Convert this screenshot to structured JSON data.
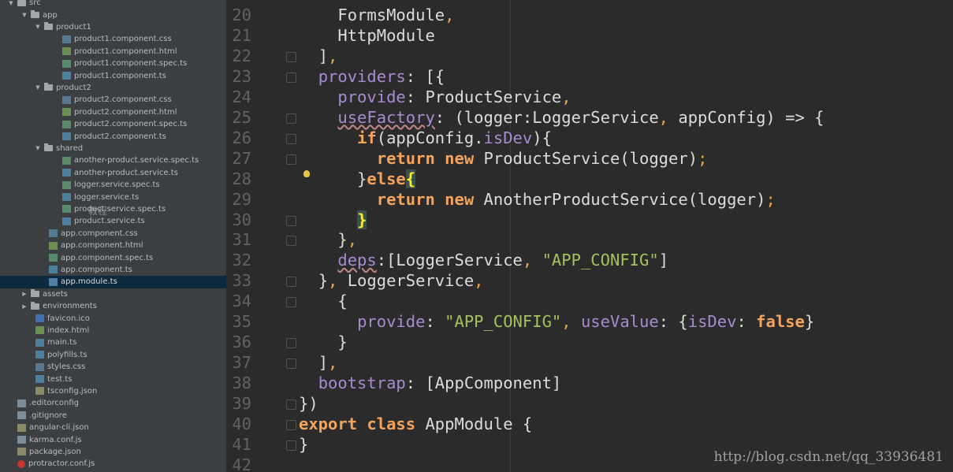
{
  "sidebar": {
    "items": [
      {
        "label": "src",
        "type": "folder",
        "indent": 0,
        "expanded": true
      },
      {
        "label": "app",
        "type": "folder",
        "indent": 1,
        "expanded": true
      },
      {
        "label": "product1",
        "type": "folder",
        "indent": 2,
        "expanded": true
      },
      {
        "label": "product1.component.css",
        "type": "css",
        "indent": 3
      },
      {
        "label": "product1.component.html",
        "type": "html",
        "indent": 3
      },
      {
        "label": "product1.component.spec.ts",
        "type": "spec",
        "indent": 3
      },
      {
        "label": "product1.component.ts",
        "type": "ts",
        "indent": 3
      },
      {
        "label": "product2",
        "type": "folder",
        "indent": 2,
        "expanded": true
      },
      {
        "label": "product2.component.css",
        "type": "css",
        "indent": 3
      },
      {
        "label": "product2.component.html",
        "type": "html",
        "indent": 3
      },
      {
        "label": "product2.component.spec.ts",
        "type": "spec",
        "indent": 3
      },
      {
        "label": "product2.component.ts",
        "type": "ts",
        "indent": 3
      },
      {
        "label": "shared",
        "type": "folder",
        "indent": 2,
        "expanded": true
      },
      {
        "label": "another-product.service.spec.ts",
        "type": "spec",
        "indent": 3
      },
      {
        "label": "another-product.service.ts",
        "type": "ts",
        "indent": 3
      },
      {
        "label": "logger.service.spec.ts",
        "type": "spec",
        "indent": 3
      },
      {
        "label": "logger.service.ts",
        "type": "ts",
        "indent": 3
      },
      {
        "label": "product.service.spec.ts",
        "type": "spec",
        "indent": 3
      },
      {
        "label": "product.service.ts",
        "type": "ts",
        "indent": 3
      },
      {
        "label": "app.component.css",
        "type": "css",
        "indent": 2
      },
      {
        "label": "app.component.html",
        "type": "html",
        "indent": 2
      },
      {
        "label": "app.component.spec.ts",
        "type": "spec",
        "indent": 2
      },
      {
        "label": "app.component.ts",
        "type": "ts",
        "indent": 2
      },
      {
        "label": "app.module.ts",
        "type": "ts",
        "indent": 2,
        "selected": true
      },
      {
        "label": "assets",
        "type": "folder",
        "indent": 1,
        "expanded": false
      },
      {
        "label": "environments",
        "type": "folder",
        "indent": 1,
        "expanded": false
      },
      {
        "label": "favicon.ico",
        "type": "ico",
        "indent": 1
      },
      {
        "label": "index.html",
        "type": "html",
        "indent": 1
      },
      {
        "label": "main.ts",
        "type": "ts",
        "indent": 1
      },
      {
        "label": "polyfills.ts",
        "type": "ts",
        "indent": 1
      },
      {
        "label": "styles.css",
        "type": "css",
        "indent": 1
      },
      {
        "label": "test.ts",
        "type": "ts",
        "indent": 1
      },
      {
        "label": "tsconfig.json",
        "type": "json",
        "indent": 1
      },
      {
        "label": ".editorconfig",
        "type": "plain",
        "indent": 0
      },
      {
        "label": ".gitignore",
        "type": "plain",
        "indent": 0
      },
      {
        "label": "angular-cli.json",
        "type": "json",
        "indent": 0
      },
      {
        "label": "karma.conf.js",
        "type": "plain",
        "indent": 0
      },
      {
        "label": "package.json",
        "type": "json",
        "indent": 0
      },
      {
        "label": "protractor.conf.js",
        "type": "proto",
        "indent": 0
      }
    ],
    "overlay_text": "教程"
  },
  "editor": {
    "lines": [
      {
        "num": "20",
        "tokens": [
          [
            "    ",
            "plain"
          ],
          [
            "FormsModule",
            "plain"
          ],
          [
            ",",
            "punc"
          ]
        ]
      },
      {
        "num": "21",
        "tokens": [
          [
            "    ",
            "plain"
          ],
          [
            "HttpModule",
            "plain"
          ]
        ]
      },
      {
        "num": "22",
        "tokens": [
          [
            "  ",
            "plain"
          ],
          [
            "]",
            "plain"
          ],
          [
            ",",
            "punc"
          ]
        ]
      },
      {
        "num": "23",
        "tokens": [
          [
            "  ",
            "plain"
          ],
          [
            "providers",
            "prop"
          ],
          [
            ": [{",
            "plain"
          ]
        ]
      },
      {
        "num": "24",
        "tokens": [
          [
            "    ",
            "plain"
          ],
          [
            "provide",
            "prop"
          ],
          [
            ": ProductService",
            "plain"
          ],
          [
            ",",
            "punc"
          ]
        ]
      },
      {
        "num": "25",
        "tokens": [
          [
            "    ",
            "plain"
          ],
          [
            "useFactory",
            "prop squig"
          ],
          [
            ": (logger:LoggerService",
            "plain"
          ],
          [
            ",",
            "punc"
          ],
          [
            " appConfig) => {",
            "plain"
          ]
        ]
      },
      {
        "num": "26",
        "tokens": [
          [
            "      ",
            "plain"
          ],
          [
            "if",
            "kw"
          ],
          [
            "(appConfig.",
            "plain"
          ],
          [
            "isDev",
            "prop"
          ],
          [
            "){",
            "plain"
          ]
        ]
      },
      {
        "num": "27",
        "tokens": [
          [
            "        ",
            "plain"
          ],
          [
            "return",
            "kw"
          ],
          [
            " ",
            "plain"
          ],
          [
            "new",
            "kw"
          ],
          [
            " ProductService(logger)",
            "plain"
          ],
          [
            ";",
            "punc"
          ]
        ]
      },
      {
        "num": "28",
        "tokens": [
          [
            "      ",
            "plain"
          ],
          [
            "}",
            "plain"
          ],
          [
            "else",
            "kw"
          ],
          [
            "{",
            "brace-hl"
          ]
        ]
      },
      {
        "num": "29",
        "tokens": [
          [
            "        ",
            "plain"
          ],
          [
            "return",
            "kw"
          ],
          [
            " ",
            "plain"
          ],
          [
            "new",
            "kw"
          ],
          [
            " AnotherProductService(logger)",
            "plain"
          ],
          [
            ";",
            "punc"
          ]
        ]
      },
      {
        "num": "30",
        "tokens": [
          [
            "      ",
            "plain"
          ],
          [
            "}",
            "brace-hl"
          ]
        ]
      },
      {
        "num": "31",
        "tokens": [
          [
            "    ",
            "plain"
          ],
          [
            "}",
            "plain"
          ],
          [
            ",",
            "punc"
          ]
        ]
      },
      {
        "num": "32",
        "tokens": [
          [
            "    ",
            "plain"
          ],
          [
            "deps",
            "prop squig"
          ],
          [
            ":[LoggerService",
            "plain"
          ],
          [
            ",",
            "punc"
          ],
          [
            " ",
            "plain"
          ],
          [
            "\"APP_CONFIG\"",
            "str"
          ],
          [
            "]",
            "plain"
          ]
        ]
      },
      {
        "num": "33",
        "tokens": [
          [
            "  ",
            "plain"
          ],
          [
            "}",
            "plain"
          ],
          [
            ",",
            "punc"
          ],
          [
            " LoggerService",
            "plain"
          ],
          [
            ",",
            "punc"
          ]
        ]
      },
      {
        "num": "34",
        "tokens": [
          [
            "    ",
            "plain"
          ],
          [
            "{",
            "plain"
          ]
        ]
      },
      {
        "num": "35",
        "tokens": [
          [
            "      ",
            "plain"
          ],
          [
            "provide",
            "prop"
          ],
          [
            ": ",
            "plain"
          ],
          [
            "\"APP_CONFIG\"",
            "str"
          ],
          [
            ",",
            "punc"
          ],
          [
            " ",
            "plain"
          ],
          [
            "useValue",
            "prop"
          ],
          [
            ": {",
            "plain"
          ],
          [
            "isDev",
            "prop"
          ],
          [
            ": ",
            "plain"
          ],
          [
            "false",
            "kw"
          ],
          [
            "}",
            "plain"
          ]
        ]
      },
      {
        "num": "36",
        "tokens": [
          [
            "    ",
            "plain"
          ],
          [
            "}",
            "plain"
          ]
        ]
      },
      {
        "num": "37",
        "tokens": [
          [
            "  ",
            "plain"
          ],
          [
            "]",
            "plain"
          ],
          [
            ",",
            "punc"
          ]
        ]
      },
      {
        "num": "38",
        "tokens": [
          [
            "  ",
            "plain"
          ],
          [
            "bootstrap",
            "prop"
          ],
          [
            ": [AppComponent]",
            "plain"
          ]
        ]
      },
      {
        "num": "39",
        "tokens": [
          [
            "})",
            "plain"
          ]
        ]
      },
      {
        "num": "40",
        "tokens": [
          [
            "export",
            "kw"
          ],
          [
            " ",
            "plain"
          ],
          [
            "class",
            "kw"
          ],
          [
            " AppModule {",
            "plain"
          ]
        ]
      },
      {
        "num": "41",
        "tokens": [
          [
            "}",
            "plain"
          ]
        ]
      },
      {
        "num": "42",
        "tokens": []
      }
    ]
  },
  "watermark": "http://blog.csdn.net/qq_33936481"
}
